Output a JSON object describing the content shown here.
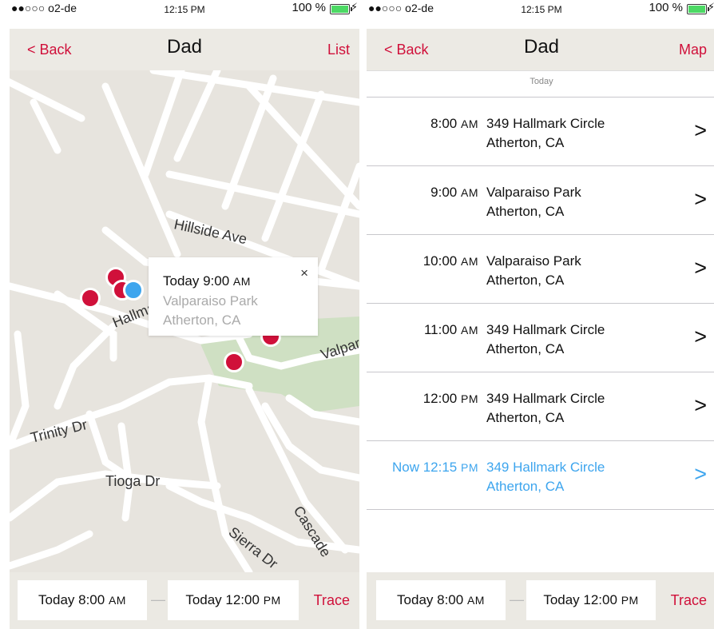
{
  "status": {
    "carrier": "●●○○○ o2-de",
    "time": "12:15 PM",
    "battery": "100 %"
  },
  "map_screen": {
    "nav": {
      "back": "< Back",
      "title": "Dad",
      "right": "List"
    },
    "streets": [
      "Hillside Ave",
      "Hallmark",
      "Valparaiso",
      "Trinity Dr",
      "Tioga Dr",
      "Sierra Dr",
      "Cascade"
    ],
    "callout": {
      "time": "Today 9:00",
      "ampm": "AM",
      "place": "Valparaiso Park",
      "city": "Atherton, CA",
      "close": "×"
    },
    "bottom": {
      "from": "Today 8:00",
      "from_ampm": "AM",
      "dash": "—",
      "to": "Today 12:00",
      "to_ampm": "PM",
      "trace": "Trace"
    }
  },
  "list_screen": {
    "nav": {
      "back": "< Back",
      "title": "Dad",
      "right": "Map"
    },
    "section": "Today",
    "rows": [
      {
        "time": "8:00",
        "ampm": "AM",
        "address": "349 Hallmark Circle",
        "city": "Atherton, CA"
      },
      {
        "time": "9:00",
        "ampm": "AM",
        "address": "Valparaiso Park",
        "city": "Atherton, CA"
      },
      {
        "time": "10:00",
        "ampm": "AM",
        "address": "Valparaiso Park",
        "city": "Atherton, CA"
      },
      {
        "time": "11:00",
        "ampm": "AM",
        "address": "349 Hallmark Circle",
        "city": "Atherton, CA"
      },
      {
        "time": "12:00",
        "ampm": "PM",
        "address": "349 Hallmark Circle",
        "city": "Atherton, CA"
      },
      {
        "time": "Now 12:15",
        "ampm": "PM",
        "address": "349 Hallmark Circle",
        "city": "Atherton, CA"
      }
    ],
    "chevron": ">",
    "bottom": {
      "from": "Today 8:00",
      "from_ampm": "AM",
      "dash": "—",
      "to": "Today 12:00",
      "to_ampm": "PM",
      "trace": "Trace"
    }
  },
  "colors": {
    "accent": "#d0103a",
    "current": "#3da5ee",
    "map_bg": "#e7e4de",
    "park": "#cfe0c3"
  }
}
